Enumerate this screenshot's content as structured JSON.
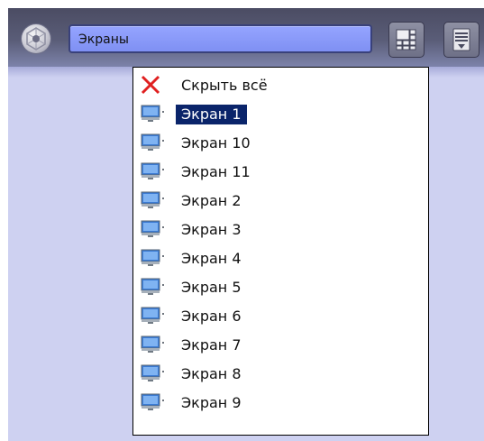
{
  "toolbar": {
    "logo_icon": "logo-icon",
    "combo_value": "Экраны",
    "layout_icon": "layout-grid-icon",
    "menu_icon": "menu-icon"
  },
  "colors": {
    "toolbar_top": "#4b4c63",
    "toolbar_bottom": "#7d83aa",
    "panel_bg": "#ced1f1",
    "combo_bg": "#8a9bff",
    "selection_bg": "#0a246a"
  },
  "dropdown": {
    "hide_all": {
      "label": "Скрыть всё",
      "icon": "red-x-icon"
    },
    "items": [
      {
        "label": "Экран 1",
        "icon": "monitor-icon",
        "selected": true
      },
      {
        "label": "Экран 10",
        "icon": "monitor-icon"
      },
      {
        "label": "Экран 11",
        "icon": "monitor-icon"
      },
      {
        "label": "Экран 2",
        "icon": "monitor-icon"
      },
      {
        "label": "Экран 3",
        "icon": "monitor-icon"
      },
      {
        "label": "Экран 4",
        "icon": "monitor-icon"
      },
      {
        "label": "Экран 5",
        "icon": "monitor-icon"
      },
      {
        "label": "Экран 6",
        "icon": "monitor-icon"
      },
      {
        "label": "Экран 7",
        "icon": "monitor-icon"
      },
      {
        "label": "Экран 8",
        "icon": "monitor-icon"
      },
      {
        "label": "Экран 9",
        "icon": "monitor-icon"
      }
    ]
  }
}
